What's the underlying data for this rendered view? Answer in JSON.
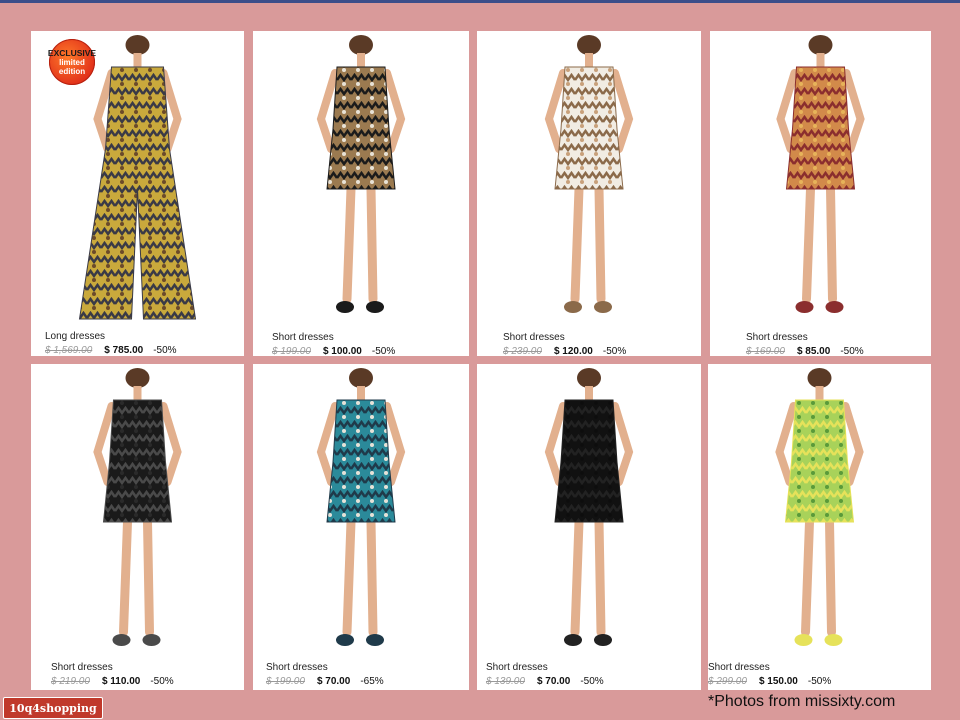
{
  "badge": {
    "line1": "EXCLUSIVE",
    "line2": "limited",
    "line3": "edition"
  },
  "products": [
    {
      "category": "Long dresses",
      "old_price": "$ 1,569.00",
      "price": "$ 785.00",
      "discount": "-50%",
      "colors": [
        "#c9a93c",
        "#3a3a46",
        "#6b4a2a"
      ]
    },
    {
      "category": "Short dresses",
      "old_price": "$ 199.00",
      "price": "$ 100.00",
      "discount": "-50%",
      "colors": [
        "#9b7a50",
        "#1b1b1b",
        "#e8e2d6"
      ]
    },
    {
      "category": "Short dresses",
      "old_price": "$ 239.00",
      "price": "$ 120.00",
      "discount": "-50%",
      "colors": [
        "#f1ece3",
        "#8b6a4a",
        "#c8a07a"
      ]
    },
    {
      "category": "Short dresses",
      "old_price": "$ 169.00",
      "price": "$ 85.00",
      "discount": "-50%",
      "colors": [
        "#d28a4a",
        "#8b2e2e",
        "#e7b35a"
      ]
    },
    {
      "category": "Short dresses",
      "old_price": "$ 219.00",
      "price": "$ 110.00",
      "discount": "-50%",
      "colors": [
        "#1a1a1a",
        "#4a4a4a",
        "#2a2a2a"
      ]
    },
    {
      "category": "Short dresses",
      "old_price": "$ 199.00",
      "price": "$ 70.00",
      "discount": "-65%",
      "colors": [
        "#2b8a9a",
        "#1f3a4a",
        "#e6e2d8"
      ]
    },
    {
      "category": "Short dresses",
      "old_price": "$ 139.00",
      "price": "$ 70.00",
      "discount": "-50%",
      "colors": [
        "#111111",
        "#222222",
        "#0d0d0d"
      ]
    },
    {
      "category": "Short dresses",
      "old_price": "$ 299.00",
      "price": "$ 150.00",
      "discount": "-50%",
      "colors": [
        "#a8d25a",
        "#e6e25a",
        "#5a9a3a"
      ]
    }
  ],
  "caption": "*Photos from missixty.com",
  "logo_text": "10q4shopping"
}
